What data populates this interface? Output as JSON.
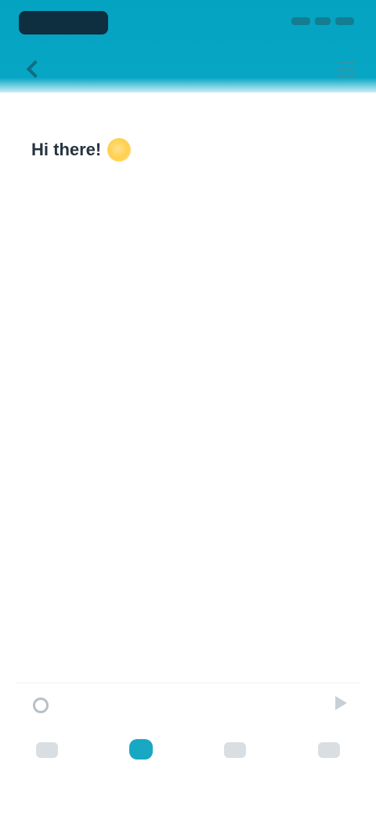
{
  "header": {
    "logo": "app-logo",
    "back_icon": "chevron-left-icon",
    "menu_icon": "menu-icon"
  },
  "message": {
    "greeting": "Hi there!",
    "greeting_icon": "waving-hand-icon",
    "body": "",
    "detail": ""
  },
  "composer": {
    "placeholder": "",
    "attach_icon": "attachment-icon",
    "send_icon": "send-icon"
  },
  "nav": {
    "items": [
      {
        "label": "",
        "icon": "home-icon",
        "active": false
      },
      {
        "label": "",
        "icon": "chat-icon",
        "active": true
      },
      {
        "label": "",
        "icon": "contacts-icon",
        "active": false
      },
      {
        "label": "",
        "icon": "profile-icon",
        "active": false
      }
    ]
  },
  "colors": {
    "header": "#07a6c4",
    "accent": "#19a8c4",
    "text": "#273440"
  }
}
